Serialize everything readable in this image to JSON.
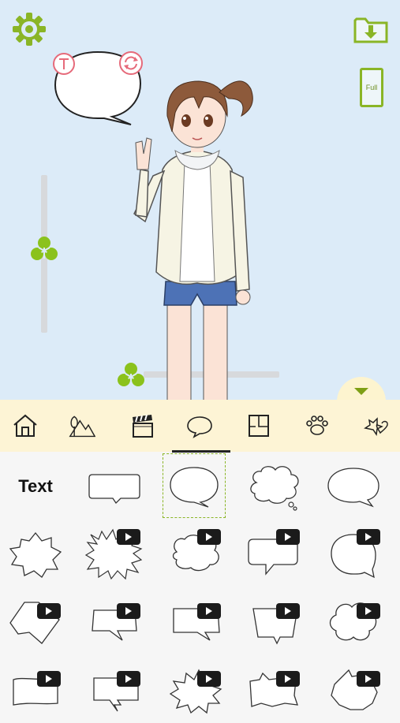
{
  "canvas": {
    "background": "#dcebf8",
    "full_label": "Full",
    "settings_icon": "gear-icon",
    "download_icon": "folder-download-icon",
    "bubble_text_icon": "text-t-icon",
    "bubble_rotate_icon": "rotate-icon"
  },
  "toolbar": {
    "accent": "#8ab526",
    "items": [
      {
        "name": "home-icon"
      },
      {
        "name": "scenery-icon"
      },
      {
        "name": "clapperboard-icon"
      },
      {
        "name": "speech-bubble-icon"
      },
      {
        "name": "panel-layout-icon"
      },
      {
        "name": "paw-icon"
      },
      {
        "name": "stamp-icon"
      }
    ],
    "active_index": 3
  },
  "bubbles": {
    "text_label": "Text",
    "selected_index": 2
  }
}
